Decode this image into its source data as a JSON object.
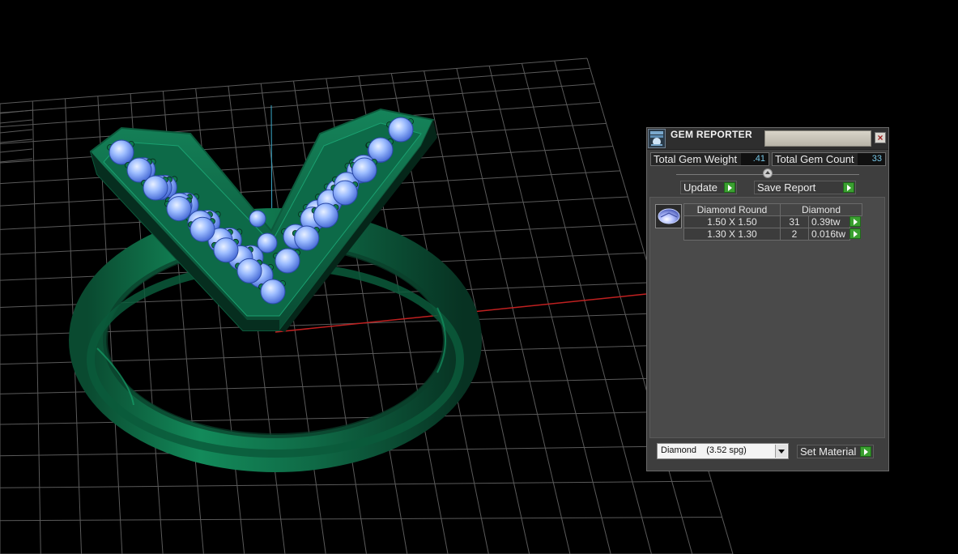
{
  "panel": {
    "title": "GEM REPORTER",
    "total_weight_label": "Total Gem Weight",
    "total_weight_value": ".41",
    "total_count_label": "Total Gem Count",
    "total_count_value": "33",
    "update_label": "Update",
    "save_report_label": "Save Report",
    "table": {
      "headers": [
        "Diamond Round",
        "Diamond"
      ],
      "rows": [
        {
          "size": "1.50 X 1.50",
          "count": "31",
          "weight": "0.39tw"
        },
        {
          "size": "1.30 X 1.30",
          "count": "2",
          "weight": "0.016tw"
        }
      ]
    },
    "material_selected": "Diamond    (3.52 spg)",
    "set_material_label": "Set Material"
  },
  "icons": {
    "close": "close-icon",
    "app": "gem-reporter-icon",
    "gem_thumb": "round-diamond-icon",
    "arrow": "play-arrow-icon",
    "dropdown": "chevron-down-icon"
  },
  "colors": {
    "viewport_bg": "#000000",
    "ring": "#0f6a46",
    "gem": "#8fb4ff",
    "x_axis": "#c02020",
    "y_axis": "#3aa8c8",
    "value_text": "#78c8e8",
    "button_arrow": "#3aa030"
  }
}
